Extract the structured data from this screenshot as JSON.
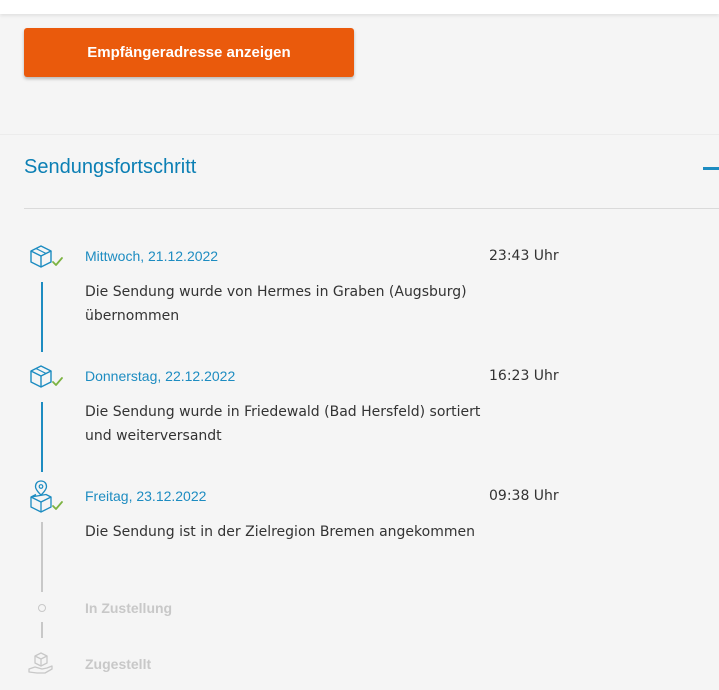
{
  "actions": {
    "recipient_button_label": "Empfängeradresse anzeigen"
  },
  "progress": {
    "title": "Sendungsfortschritt",
    "events": [
      {
        "date": "Mittwoch, 21.12.2022",
        "time": "23:43 Uhr",
        "description": "Die Sendung wurde von Hermes in Graben (Augsburg) übernommen",
        "icon": "box-check-icon"
      },
      {
        "date": "Donnerstag, 22.12.2022",
        "time": "16:23 Uhr",
        "description": "Die Sendung wurde in Friedewald (Bad Hersfeld) sortiert und weiterversandt",
        "icon": "box-check-icon"
      },
      {
        "date": "Freitag, 23.12.2022",
        "time": "09:38 Uhr",
        "description": "Die Sendung ist in der Zielregion Bremen angekommen",
        "icon": "location-box-check-icon"
      }
    ],
    "pending": [
      {
        "label": "In Zustellung",
        "icon": "dot-icon"
      },
      {
        "label": "Zugestellt",
        "icon": "hand-box-icon"
      }
    ]
  },
  "colors": {
    "accent": "#1d8cc1",
    "button": "#ea5a0c",
    "check": "#7cb342",
    "pending": "#c8c8c8"
  }
}
